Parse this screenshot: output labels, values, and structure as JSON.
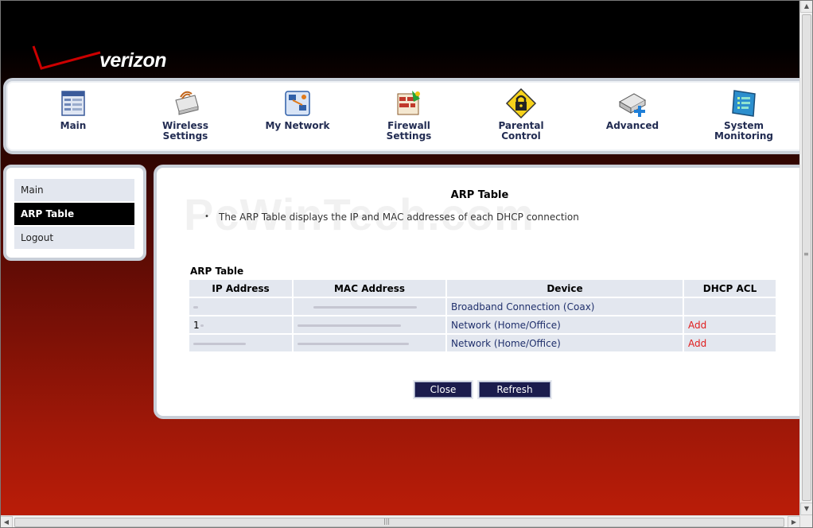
{
  "brand": {
    "logo_text": "verizon",
    "accent_color": "#cc0000"
  },
  "nav": {
    "items": [
      {
        "label": "Main",
        "icon": "main-icon"
      },
      {
        "label": "Wireless\nSettings",
        "icon": "wireless-settings-icon"
      },
      {
        "label": "My Network",
        "icon": "my-network-icon"
      },
      {
        "label": "Firewall\nSettings",
        "icon": "firewall-settings-icon"
      },
      {
        "label": "Parental\nControl",
        "icon": "parental-control-icon"
      },
      {
        "label": "Advanced",
        "icon": "advanced-icon"
      },
      {
        "label": "System\nMonitoring",
        "icon": "system-monitoring-icon"
      }
    ]
  },
  "sidebar": {
    "items": [
      {
        "label": "Main"
      },
      {
        "label": "ARP Table",
        "active": true
      },
      {
        "label": "Logout"
      }
    ]
  },
  "main": {
    "title": "ARP Table",
    "description": "The ARP Table displays the IP and MAC addresses of each DHCP connection",
    "watermark": "PcWinTech.com",
    "table_title": "ARP Table",
    "columns": [
      "IP Address",
      "MAC Address",
      "Device",
      "DHCP ACL"
    ],
    "rows": [
      {
        "ip": "",
        "mac": "",
        "device": "Broadband Connection (Coax)",
        "acl": ""
      },
      {
        "ip": "1",
        "mac": "",
        "device": "Network (Home/Office)",
        "acl": "Add"
      },
      {
        "ip": "",
        "mac": "",
        "device": "Network (Home/Office)",
        "acl": "Add"
      }
    ],
    "buttons": {
      "close": "Close",
      "refresh": "Refresh"
    }
  }
}
